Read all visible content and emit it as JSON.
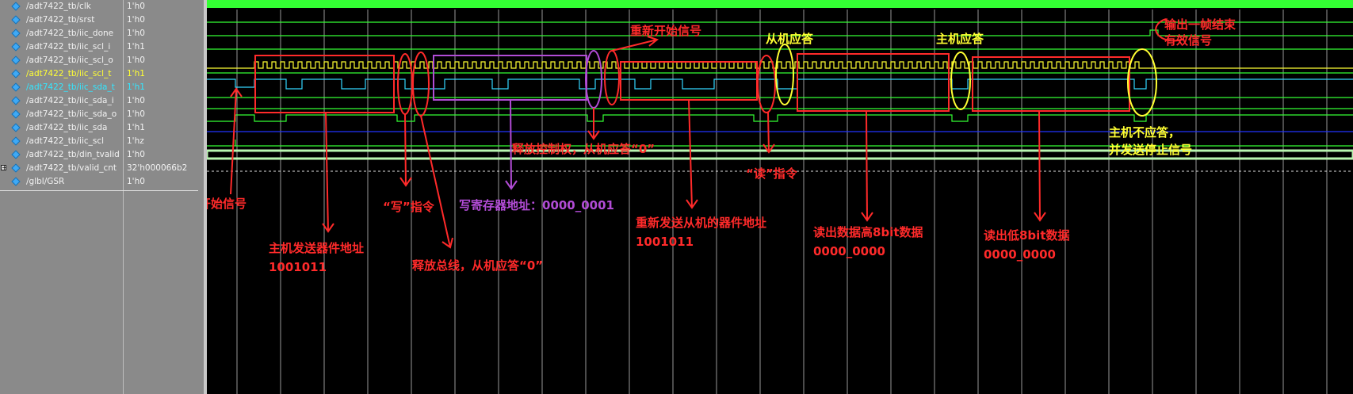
{
  "signals": [
    {
      "name": "/adt7422_tb/clk",
      "value": "1'h0"
    },
    {
      "name": "/adt7422_tb/srst",
      "value": "1'h0"
    },
    {
      "name": "/adt7422_tb/iic_done",
      "value": "1'h0"
    },
    {
      "name": "/adt7422_tb/iic_scl_i",
      "value": "1'h1"
    },
    {
      "name": "/adt7422_tb/iic_scl_o",
      "value": "1'h0"
    },
    {
      "name": "/adt7422_tb/iic_scl_t",
      "value": "1'h1",
      "highlight": "#ffff33"
    },
    {
      "name": "/adt7422_tb/iic_sda_t",
      "value": "1'h1",
      "highlight": "#33e6ff"
    },
    {
      "name": "/adt7422_tb/iic_sda_i",
      "value": "1'h0"
    },
    {
      "name": "/adt7422_tb/iic_sda_o",
      "value": "1'h0"
    },
    {
      "name": "/adt7422_tb/iic_sda",
      "value": "1'h1"
    },
    {
      "name": "/adt7422_tb/iic_scl",
      "value": "1'hz"
    },
    {
      "name": "/adt7422_tb/din_tvalid",
      "value": "1'h0"
    },
    {
      "name": "/adt7422_tb/valid_cnt",
      "value": "32'h000066b2",
      "expandable": true,
      "expand_glyph": "+"
    },
    {
      "name": "/glbl/GSR",
      "value": "1'h0"
    }
  ],
  "annotations": {
    "start_signal": "开始信号",
    "master_send_addr": "主机发送器件地址",
    "master_send_addr_bits": "1001011",
    "write_cmd": "“写”指令",
    "release_bus": "释放总线，从机应答“0”",
    "write_reg_addr": "写寄存器地址：0000_0001",
    "release_ctrl": "释放控制权，从机应答“0”",
    "restart_signal": "重新开始信号",
    "resend_addr": "重新发送从机的器件地址",
    "resend_addr_bits": "1001011",
    "read_cmd": "“读”指令",
    "slave_ack": "从机应答",
    "read_high": "读出数据高8bit数据",
    "read_high_bits": "0000_0000",
    "master_ack": "主机应答",
    "read_low": "读出低8bit数据",
    "read_low_bits": "0000_0000",
    "master_nack_1": "主机不应答，",
    "master_nack_2": "并发送停止信号",
    "frame_end_1": "输出一帧结束",
    "frame_end_2": "有效信号"
  },
  "colors": {
    "annotation_red": "#ff2a2a",
    "annotation_yellow": "#ffff33",
    "annotation_purple": "#b24cd6",
    "wave_green": "#33ff33",
    "wave_yellow": "#ffff33",
    "wave_cyan": "#33d6ff",
    "wave_blue": "#2233ff",
    "bus_green": "#b8f5b0"
  }
}
